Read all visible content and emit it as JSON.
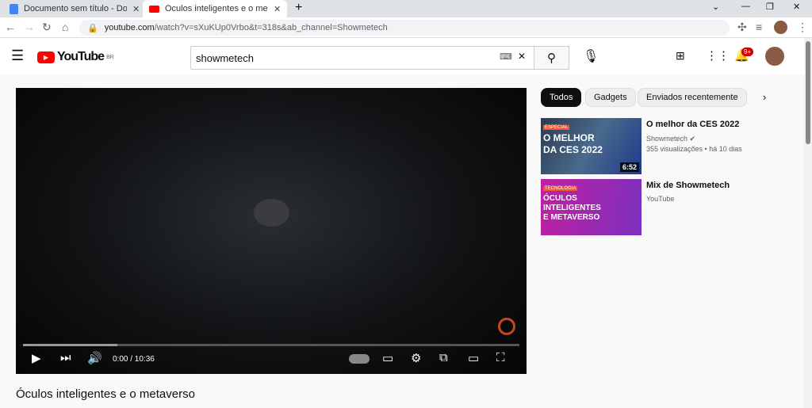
{
  "browser": {
    "tabs": [
      {
        "title": "Documento sem título - Documentos Google",
        "icon": "docs-icon"
      },
      {
        "title": "Óculos inteligentes e o metaverso - YouTube",
        "icon": "youtube-icon",
        "active": true
      }
    ],
    "url_domain": "youtube.com",
    "url_path": "/watch?v=sXuKUp0Vrbo&t=318s&ab_channel=Showmetech"
  },
  "youtube": {
    "logo": "YouTube",
    "region": "BR",
    "search_value": "showmetech",
    "notifications": "9+"
  },
  "player": {
    "time": "0:00 / 10:36",
    "progress": 0.19
  },
  "video_title": "Óculos inteligentes e o metaverso",
  "chips": [
    "Todos",
    "Gadgets",
    "Enviados recentemente"
  ],
  "related": [
    {
      "title": "O melhor da CES 2022",
      "channel": "Showmetech",
      "meta": "355 visualizações • há 10 dias",
      "duration": "6:52",
      "thumb_tag": "ESPECIAL",
      "thumb_text": "O MELHOR DA CES 2022"
    },
    {
      "title": "Mix de Showmetech",
      "channel": "YouTube",
      "thumb_tag": "TECNOLOGIA",
      "thumb_text": "ÓCULOS INTELIGENTES E METAVERSO"
    }
  ]
}
